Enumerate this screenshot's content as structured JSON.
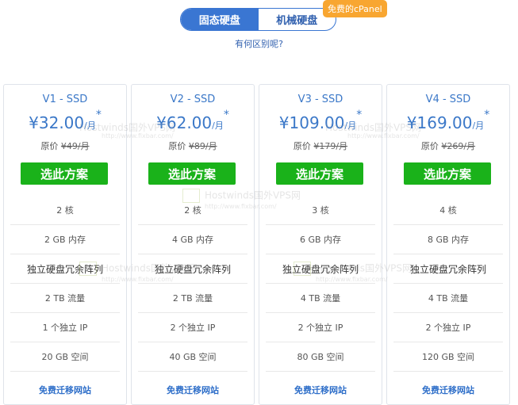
{
  "toggle": {
    "active": "固态硬盘",
    "inactive": "机械硬盘",
    "badge": "免费的cPanel"
  },
  "diff_link": "有何区别呢?",
  "plans": [
    {
      "name": "V1 - SSD",
      "currency": "¥",
      "price": "32.00",
      "unit": "/月",
      "star": "*",
      "orig_label": "原价",
      "orig_price": "¥49/月",
      "button": "选此方案",
      "features": [
        "2 核",
        "2 GB 内存",
        "独立硬盘冗余阵列",
        "2 TB 流量",
        "1 个独立 IP",
        "20 GB 空间"
      ],
      "migrate": "免费迁移网站"
    },
    {
      "name": "V2 - SSD",
      "currency": "¥",
      "price": "62.00",
      "unit": "/月",
      "star": "*",
      "orig_label": "原价",
      "orig_price": "¥89/月",
      "button": "选此方案",
      "features": [
        "2 核",
        "4 GB 内存",
        "独立硬盘冗余阵列",
        "2 TB 流量",
        "2 个独立 IP",
        "40 GB 空间"
      ],
      "migrate": "免费迁移网站"
    },
    {
      "name": "V3 - SSD",
      "currency": "¥",
      "price": "109.00",
      "unit": "/月",
      "star": "*",
      "orig_label": "原价",
      "orig_price": "¥179/月",
      "button": "选此方案",
      "features": [
        "3 核",
        "6 GB 内存",
        "独立硬盘冗余阵列",
        "4 TB 流量",
        "2 个独立 IP",
        "80 GB 空间"
      ],
      "migrate": "免费迁移网站"
    },
    {
      "name": "V4 - SSD",
      "currency": "¥",
      "price": "169.00",
      "unit": "/月",
      "star": "*",
      "orig_label": "原价",
      "orig_price": "¥269/月",
      "button": "选此方案",
      "features": [
        "4 核",
        "8 GB 内存",
        "独立硬盘冗余阵列",
        "4 TB 流量",
        "2 个独立 IP",
        "120 GB 空间"
      ],
      "migrate": "免费迁移网站"
    }
  ],
  "watermark": {
    "text": "Hostwinds国外VPS网",
    "url": "http://www.fixbar.com/"
  }
}
